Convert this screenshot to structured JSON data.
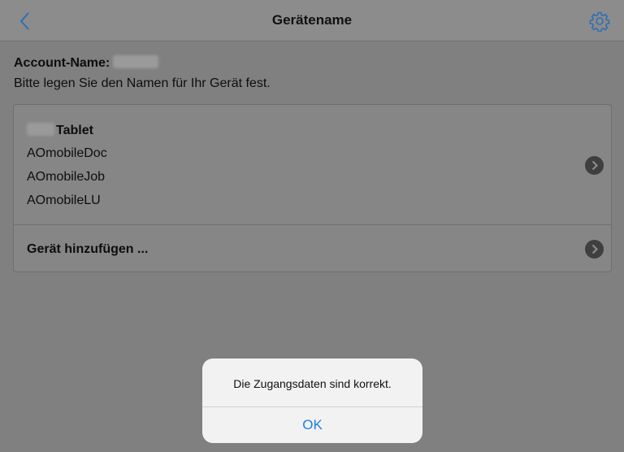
{
  "navbar": {
    "title": "Gerätename",
    "back_icon": "chevron-left-icon",
    "settings_icon": "gear-icon",
    "accent_color": "#2f6fb0"
  },
  "account": {
    "label": "Account-Name:",
    "hint": "Bitte legen Sie den Namen für Ihr Gerät fest."
  },
  "device": {
    "name_suffix": "Tablet",
    "apps": [
      "AOmobileDoc",
      "AOmobileJob",
      "AOmobileLU"
    ]
  },
  "add_device": {
    "label": "Gerät hinzufügen ..."
  },
  "alert": {
    "message": "Die Zugangsdaten sind korrekt.",
    "ok_label": "OK",
    "ok_color": "#1a7fe0"
  }
}
